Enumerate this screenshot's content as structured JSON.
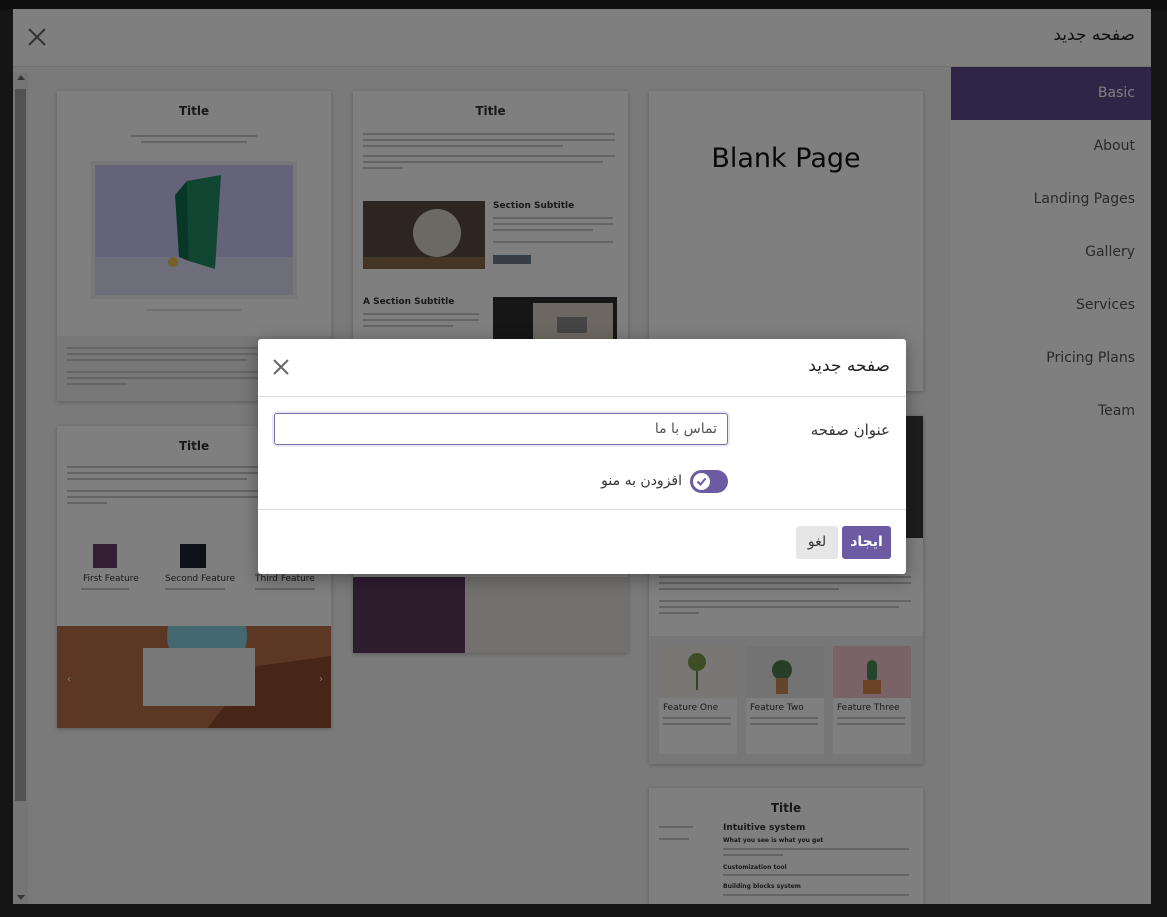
{
  "outer": {
    "title": "صفحه جدید"
  },
  "sidebar": {
    "items": [
      {
        "label": "Basic",
        "active": true
      },
      {
        "label": "About"
      },
      {
        "label": "Landing Pages"
      },
      {
        "label": "Gallery"
      },
      {
        "label": "Services"
      },
      {
        "label": "Pricing Plans"
      },
      {
        "label": "Team"
      }
    ]
  },
  "templates": {
    "t1": {
      "title": "Title"
    },
    "t2": {
      "title": "Title",
      "section_subtitle": "Section Subtitle",
      "a_section_subtitle": "A Section Subtitle"
    },
    "t3": {
      "title": "Blank Page"
    },
    "t4": {
      "title": "Title",
      "features": [
        "First Feature",
        "Second Feature",
        "Third Feature"
      ]
    },
    "t5": {
      "features": [
        "Feature One",
        "Feature Two",
        "Feature Three"
      ]
    },
    "t6": {
      "title": "Title",
      "heading": "Intuitive system",
      "sub1": "What you see is what you get",
      "sub2": "Customization tool",
      "sub3": "Building blocks system"
    }
  },
  "dialog": {
    "title": "صفحه جدید",
    "field_label": "عنوان صفحه",
    "input_value": "تماس با ما",
    "toggle_label": "افزودن به منو",
    "toggle_on": true,
    "create_label": "ایجاد",
    "cancel_label": "لغو"
  },
  "colors": {
    "accent": "#6c5ba3",
    "sidebar_active": "#5c4a8e"
  }
}
